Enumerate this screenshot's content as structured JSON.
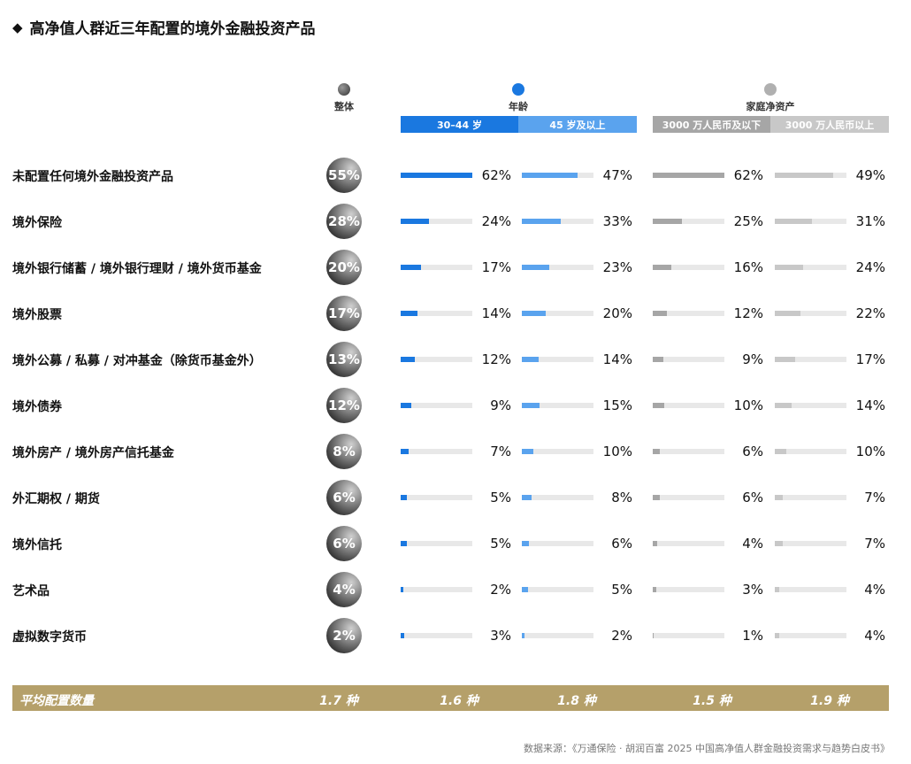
{
  "title": "高净值人群近三年配置的境外金融投资产品",
  "title_marker": "◆",
  "legend": {
    "overall": "整体",
    "age": "年龄",
    "wealth": "家庭净资产"
  },
  "column_headers": [
    "30–44 岁",
    "45 岁及以上",
    "3000 万人民币及以下",
    "3000 万人民币以上"
  ],
  "colors": {
    "age_30_44": "#1a78e0",
    "age_45_plus": "#5aa3ee",
    "wealth_low": "#a6a6a6",
    "wealth_high": "#c8c8c8",
    "footer": "#b5a06a"
  },
  "chart_data": {
    "type": "table",
    "title": "高净值人群近三年配置的境外金融投资产品",
    "series": [
      {
        "name": "整体",
        "values": [
          55,
          28,
          20,
          17,
          13,
          12,
          8,
          6,
          6,
          4,
          2
        ]
      },
      {
        "name": "30–44 岁",
        "values": [
          62,
          24,
          17,
          14,
          12,
          9,
          7,
          5,
          5,
          2,
          3
        ]
      },
      {
        "name": "45 岁及以上",
        "values": [
          47,
          33,
          23,
          20,
          14,
          15,
          10,
          8,
          6,
          5,
          2
        ]
      },
      {
        "name": "3000 万人民币及以下",
        "values": [
          62,
          25,
          16,
          12,
          9,
          10,
          6,
          6,
          4,
          3,
          1
        ]
      },
      {
        "name": "3000 万人民币以上",
        "values": [
          49,
          31,
          24,
          22,
          17,
          14,
          10,
          7,
          7,
          4,
          4
        ]
      }
    ],
    "categories": [
      "未配置任何境外金融投资产品",
      "境外保险",
      "境外银行储蓄 / 境外银行理财 / 境外货币基金",
      "境外股票",
      "境外公募 / 私募 / 对冲基金（除货币基金外）",
      "境外债券",
      "境外房产 / 境外房产信托基金",
      "外汇期权 / 期货",
      "境外信托",
      "艺术品",
      "虚拟数字货币"
    ],
    "unit": "%"
  },
  "footer": {
    "label": "平均配置数量",
    "values": [
      "1.7 种",
      "1.6 种",
      "1.8 种",
      "1.5 种",
      "1.9 种"
    ]
  },
  "source": "数据来源：《万通保险 · 胡润百富 2025 中国高净值人群金融投资需求与趋势白皮书》"
}
